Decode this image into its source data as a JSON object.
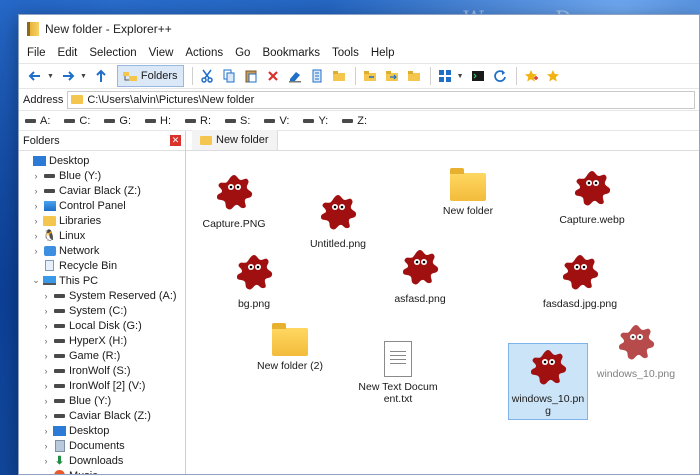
{
  "watermark": "WindowsDigitals.com",
  "window": {
    "title": "New folder - Explorer++"
  },
  "menu": [
    "File",
    "Edit",
    "Selection",
    "View",
    "Actions",
    "Go",
    "Bookmarks",
    "Tools",
    "Help"
  ],
  "toolbar": {
    "folders_label": "Folders",
    "icons": [
      "back-arrow-icon",
      "forward-arrow-icon",
      "up-arrow-icon",
      "cut-icon",
      "copy-icon",
      "paste-icon",
      "delete-icon",
      "rename-icon",
      "properties-icon",
      "new-folder-icon",
      "copy-to-icon",
      "move-to-icon",
      "views-icon",
      "command-prompt-icon",
      "refresh-icon",
      "add-bookmark-icon",
      "bookmarks-icon"
    ]
  },
  "address": {
    "label": "Address",
    "path": "C:\\Users\\alvin\\Pictures\\New folder"
  },
  "drives": [
    "A:",
    "C:",
    "G:",
    "H:",
    "R:",
    "S:",
    "V:",
    "Y:",
    "Z:"
  ],
  "tree": {
    "header": "Folders",
    "items": [
      {
        "label": "Desktop",
        "icon": "desktop-icon",
        "chev": ""
      },
      {
        "label": "Blue (Y:)",
        "icon": "drive-icon",
        "chev": "›"
      },
      {
        "label": "Caviar Black (Z:)",
        "icon": "drive-icon",
        "chev": "›"
      },
      {
        "label": "Control Panel",
        "icon": "control-panel-icon",
        "chev": "›"
      },
      {
        "label": "Libraries",
        "icon": "folder-icon",
        "chev": "›"
      },
      {
        "label": "Linux",
        "icon": "linux-icon",
        "chev": "›"
      },
      {
        "label": "Network",
        "icon": "network-icon",
        "chev": "›"
      },
      {
        "label": "Recycle Bin",
        "icon": "recycle-bin-icon",
        "chev": ""
      },
      {
        "label": "This PC",
        "icon": "pc-icon",
        "chev": "⌄"
      },
      {
        "label": "System Reserved (A:)",
        "icon": "drive-icon",
        "chev": "›"
      },
      {
        "label": "System (C:)",
        "icon": "drive-icon",
        "chev": "›"
      },
      {
        "label": "Local Disk (G:)",
        "icon": "drive-icon",
        "chev": "›"
      },
      {
        "label": "HyperX (H:)",
        "icon": "drive-icon",
        "chev": "›"
      },
      {
        "label": "Game (R:)",
        "icon": "drive-icon",
        "chev": "›"
      },
      {
        "label": "IronWolf (S:)",
        "icon": "drive-icon",
        "chev": "›"
      },
      {
        "label": "IronWolf [2] (V:)",
        "icon": "drive-icon",
        "chev": "›"
      },
      {
        "label": "Blue (Y:)",
        "icon": "drive-icon",
        "chev": "›"
      },
      {
        "label": "Caviar Black (Z:)",
        "icon": "drive-icon",
        "chev": "›"
      },
      {
        "label": "Desktop",
        "icon": "desktop-icon",
        "chev": "›"
      },
      {
        "label": "Documents",
        "icon": "documents-icon",
        "chev": "›"
      },
      {
        "label": "Downloads",
        "icon": "downloads-icon",
        "chev": "›"
      },
      {
        "label": "Music",
        "icon": "music-icon",
        "chev": "›"
      }
    ]
  },
  "tab": {
    "label": "New folder"
  },
  "files": [
    {
      "name": "Capture.PNG",
      "type": "image"
    },
    {
      "name": "Untitled.png",
      "type": "image"
    },
    {
      "name": "New folder",
      "type": "folder"
    },
    {
      "name": "Capture.webp",
      "type": "image"
    },
    {
      "name": "bg.png",
      "type": "image"
    },
    {
      "name": "asfasd.png",
      "type": "image"
    },
    {
      "name": "fasdasd.jpg.png",
      "type": "image"
    },
    {
      "name": "New folder (2)",
      "type": "folder"
    },
    {
      "name": "New Text Document.txt",
      "type": "text"
    },
    {
      "name": "windows_10.png",
      "type": "image",
      "selected": true
    },
    {
      "name": "windows_10.png",
      "type": "image",
      "ghost": true
    }
  ],
  "colors": {
    "accent": "#2b7bd6",
    "selection": "#cce4f7",
    "folder": "#f4c64d",
    "splat": "#a01010"
  }
}
